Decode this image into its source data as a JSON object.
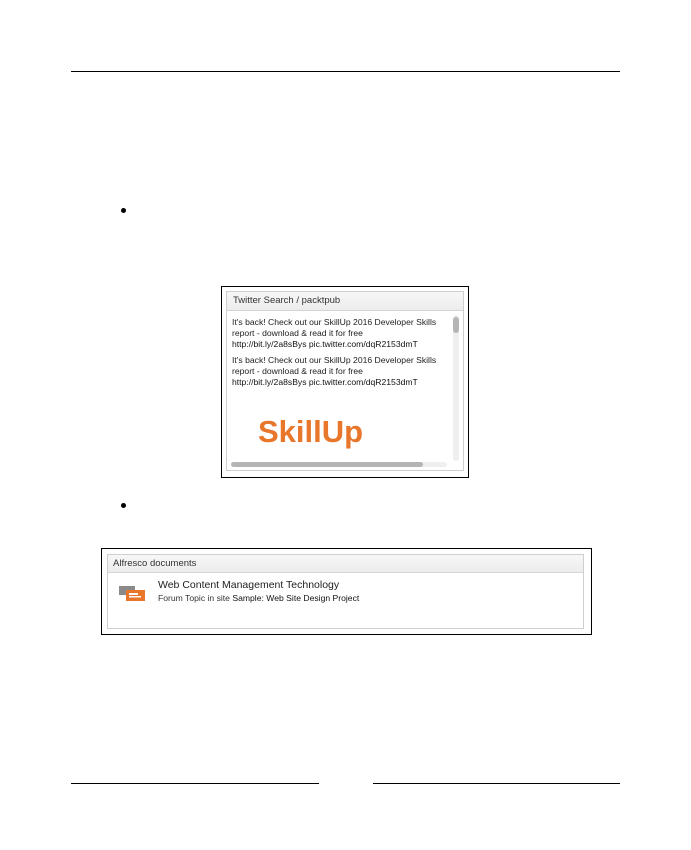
{
  "twitter_widget": {
    "title": "Twitter Search / packtpub",
    "tweets": [
      {
        "line1": "It's back! Check out our SkillUp 2016 Developer Skills",
        "line2": "report - download & read it for free",
        "link": "http://bit.ly/2a8sBys pic.twitter.com/dqR2153dmT"
      },
      {
        "line1": "It's back! Check out our SkillUp 2016 Developer Skills",
        "line2": "report - download & read it for free",
        "link": "http://bit.ly/2a8sBys pic.twitter.com/dqR2153dmT"
      }
    ],
    "image_text": "SkillUp"
  },
  "alfresco_widget": {
    "title": "Alfresco documents",
    "item": {
      "title": "Web Content Management Technology",
      "meta_prefix": "Forum Topic in site ",
      "site_name": "Sample: Web Site Design Project"
    }
  },
  "colors": {
    "skillup_orange": "#e8762b",
    "panel_border": "#cfcfcf",
    "scroll_thumb": "#b5b5b5"
  }
}
